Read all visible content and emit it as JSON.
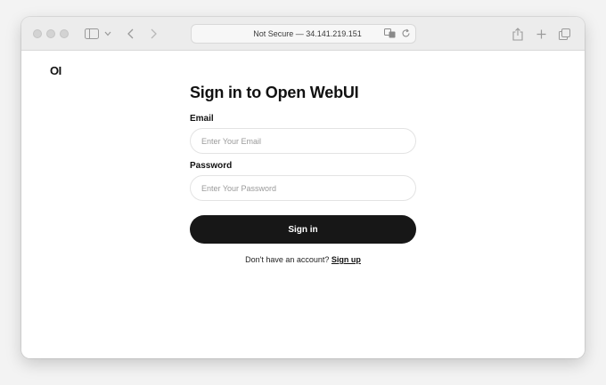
{
  "browser": {
    "address_text": "Not Secure — 34.141.219.151",
    "icons": {
      "sidebar": "sidebar-icon",
      "chevron": "chevron-down-icon",
      "back": "back-icon",
      "forward": "forward-icon",
      "translate": "translate-icon",
      "reload": "reload-icon",
      "share": "share-icon",
      "new_tab": "plus-icon",
      "tabs": "tabs-icon"
    }
  },
  "app": {
    "logo": "OI"
  },
  "login": {
    "title": "Sign in to Open WebUI",
    "email_label": "Email",
    "email_placeholder": "Enter Your Email",
    "email_value": "",
    "password_label": "Password",
    "password_placeholder": "Enter Your Password",
    "password_value": "",
    "signin_label": "Sign in",
    "no_account_text": "Don't have an account? ",
    "signup_label": "Sign up"
  },
  "colors": {
    "button_bg": "#171717",
    "button_text": "#ffffff",
    "toolbar_bg": "#ececec"
  }
}
